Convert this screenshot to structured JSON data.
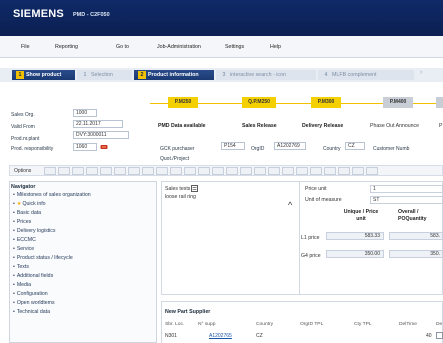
{
  "header": {
    "logo": "SIEMENS",
    "app_name": "PMD - C2F050"
  },
  "menu": {
    "items": [
      "File",
      "Reporting",
      "Go to",
      "Job-Administration",
      "Settings",
      "Help"
    ]
  },
  "steps": [
    {
      "num": "1",
      "label": "Show product",
      "active": true
    },
    {
      "num": "1",
      "label": "Selection",
      "active": false
    },
    {
      "num": "2",
      "label": "Product information",
      "active": true
    },
    {
      "num": "3",
      "label": "interactive search - icon",
      "active": false
    },
    {
      "num": "4",
      "label": "MLFB complement",
      "active": false
    }
  ],
  "product": {
    "sales_org_label": "Sales Org.",
    "sales_org_value": "1000",
    "valid_from_label": "Valid From",
    "valid_from_value": "22.11.2017",
    "prod_no_plant_label": "Prod.nr.plant",
    "prod_no_plant_value": "DVY:3000011",
    "prod_resp_label": "Prod. responsibility",
    "prod_resp_value": "1060",
    "gck_label": "GCK purchaser",
    "gck_value": "P154",
    "orgid_label": "OrgID",
    "orgid_value": "A1202769",
    "country_label": "Country",
    "country_value": "CZ",
    "customer_label": "Customer Numb",
    "quot_label": "Quot./Project"
  },
  "milestones": [
    {
      "code": "P.M250",
      "label": "PMD Data available",
      "state": "yellow"
    },
    {
      "code": "Q.P.M250",
      "label": "Sales Release",
      "state": "yellow"
    },
    {
      "code": "P.M300",
      "label": "Delivery Release",
      "state": "yellow"
    },
    {
      "code": "P.M400",
      "label": "Phase Out Announce",
      "state": "grey"
    },
    {
      "code": "",
      "label": "P",
      "state": "grey"
    }
  ],
  "options": {
    "label": "Options"
  },
  "navigator": {
    "title": "Navigator",
    "items": [
      {
        "label": "Milestones of sales organization",
        "star": false
      },
      {
        "label": "Quick info",
        "star": true
      },
      {
        "label": "Basic data",
        "star": false
      },
      {
        "label": "Prices",
        "star": false
      },
      {
        "label": "Delivery logistics",
        "star": false
      },
      {
        "label": "ECCMC",
        "star": false
      },
      {
        "label": "Service",
        "star": false
      },
      {
        "label": "Product status / lifecycle",
        "star": false
      },
      {
        "label": "Texts",
        "star": false
      },
      {
        "label": "Additional fields",
        "star": false
      },
      {
        "label": "Media",
        "star": false
      },
      {
        "label": "Configuration",
        "star": false
      },
      {
        "label": "Open worldtems",
        "star": false
      },
      {
        "label": "Technical data",
        "star": false
      }
    ]
  },
  "sales_texts": {
    "title": "Sales texts",
    "line1": "loose rail ring"
  },
  "prices": {
    "price_unit_label": "Price unit",
    "price_unit_value": "1",
    "uom_label": "Unit of measure",
    "uom_value": "ST",
    "col1_header": "Unique / Price unit",
    "col2_header": "Overall / POQuantity",
    "rows": [
      {
        "label": "L1 price",
        "v1": "583.33",
        "v2": "583."
      },
      {
        "label": "G4 price",
        "v1": "350.00",
        "v2": "350."
      }
    ]
  },
  "supplier": {
    "title": "New Part Supplier",
    "columns": [
      "Sbr. Loc.",
      "N° supp",
      "Country",
      "OrgID TPL",
      "Cty TPL",
      "DelTime",
      "De"
    ],
    "rows": [
      {
        "loc": "N301",
        "supp": "A1202765",
        "country": "CZ",
        "deltime": "40"
      }
    ]
  }
}
